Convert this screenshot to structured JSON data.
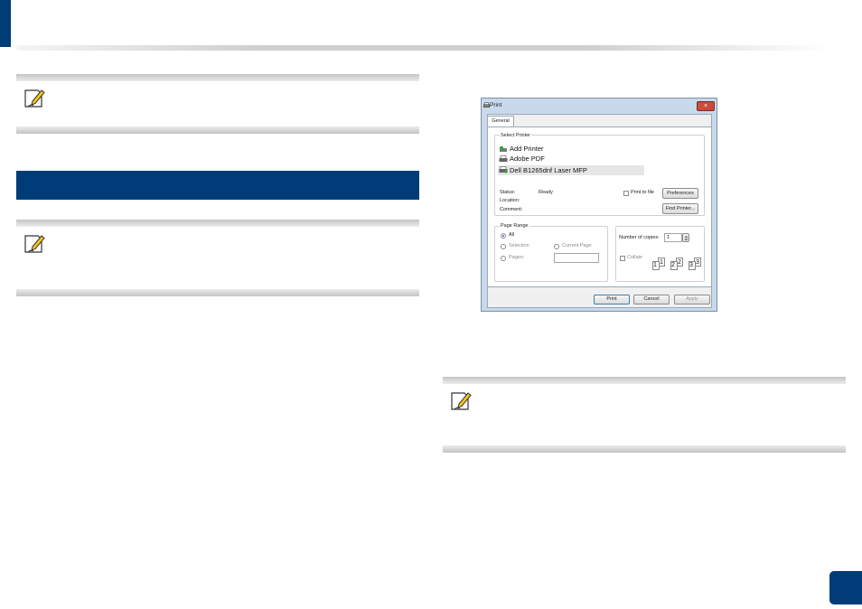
{
  "dialog": {
    "title": "Print",
    "close_glyph": "×",
    "tab_general": "General",
    "select_printer_label": "Select Printer",
    "printers": [
      "Add Printer",
      "Adobe PDF",
      "Dell B1265dnf Laser MFP"
    ],
    "status_label": "Status:",
    "status_value": "Ready",
    "location_label": "Location:",
    "comment_label": "Comment:",
    "print_to_file_label": "Print to file",
    "preferences_button": "Preferences",
    "find_printer_button": "Find Printer...",
    "page_range_label": "Page Range",
    "all_label": "All",
    "selection_label": "Selection",
    "current_page_label": "Current Page",
    "pages_label": "Pages:",
    "copies_label": "Number of copies:",
    "copies_value": "1",
    "collate_label": "Collate",
    "collate_sheets": [
      "1",
      "1",
      "2",
      "2",
      "3",
      "3"
    ],
    "print_button": "Print",
    "cancel_button": "Cancel",
    "apply_button": "Apply"
  },
  "colors": {
    "brand_blue": "#003c78",
    "note_icon_yellow": "#f5c518"
  },
  "icons": [
    "note-pencil-icon",
    "printer-icon",
    "close-icon",
    "spin-arrow-icon"
  ]
}
